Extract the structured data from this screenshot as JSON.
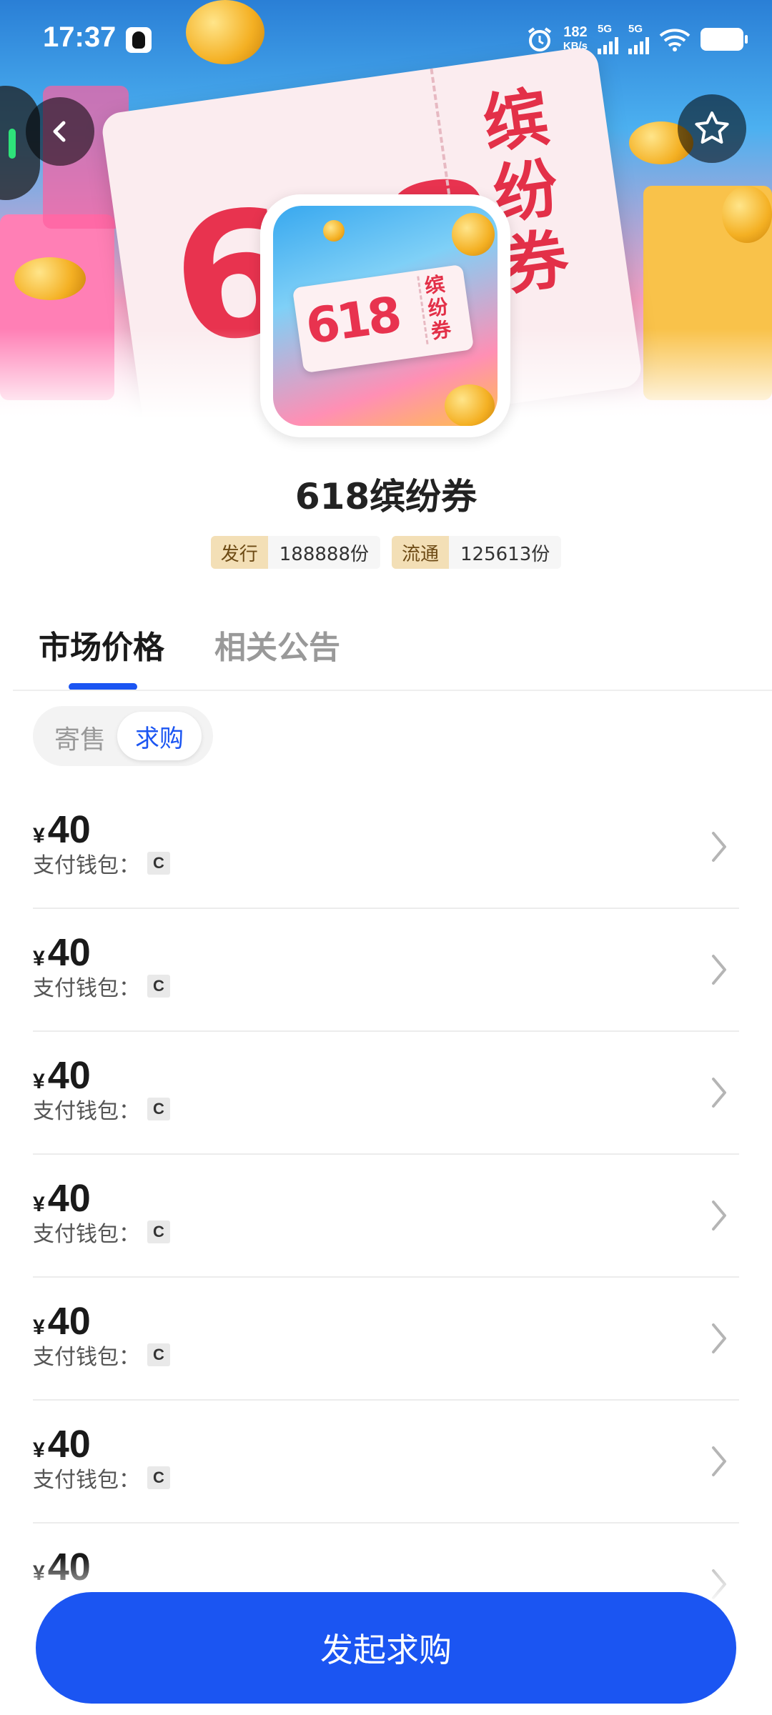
{
  "status_bar": {
    "time": "17:37",
    "net_speed": "182",
    "net_unit": "KB/s",
    "sim1": "5G",
    "sim2": "5G"
  },
  "header": {
    "back_icon": "chevron-left-icon",
    "favorite_icon": "star-icon"
  },
  "banner": {
    "big_text": "618",
    "stub_text": "缤纷券"
  },
  "product": {
    "icon_big_text": "618",
    "icon_stub_text": "缤纷券",
    "title": "618缤纷券",
    "stats": [
      {
        "key": "发行",
        "value": "188888份"
      },
      {
        "key": "流通",
        "value": "125613份"
      }
    ]
  },
  "tabs": [
    {
      "label": "市场价格",
      "active": true
    },
    {
      "label": "相关公告",
      "active": false
    }
  ],
  "segment": {
    "options": [
      "寄售",
      "求购"
    ],
    "selected": "求购"
  },
  "list": {
    "currency": "¥",
    "wallet_label": "支付钱包：",
    "items": [
      {
        "price": "40",
        "wallet": "C"
      },
      {
        "price": "40",
        "wallet": "C"
      },
      {
        "price": "40",
        "wallet": "C"
      },
      {
        "price": "40",
        "wallet": "C"
      },
      {
        "price": "40",
        "wallet": "C"
      },
      {
        "price": "40",
        "wallet": "C"
      },
      {
        "price": "40",
        "wallet": ""
      }
    ]
  },
  "cta": {
    "label": "发起求购"
  },
  "colors": {
    "accent": "#1b55f2",
    "stat_key_bg": "#f3dfb6",
    "banner_red": "#e8334f"
  }
}
